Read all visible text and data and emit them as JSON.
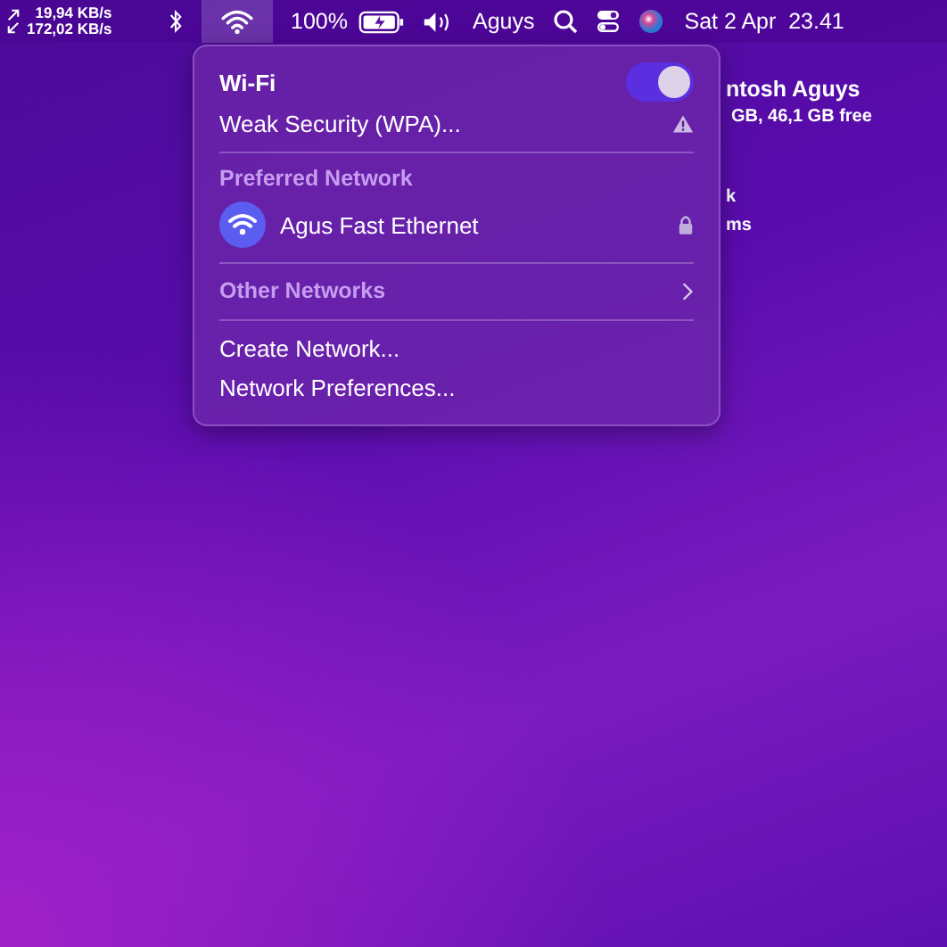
{
  "menu_bar": {
    "network_speed": {
      "upload": "19,94 KB/s",
      "download": "172,02 KB/s"
    },
    "wifi_selected": true,
    "battery": "100%",
    "user": "Aguys",
    "clock": "Sat 2 Apr  23.41"
  },
  "desktop_labels": [
    "ntosh Aguys",
    "GB, 46,1 GB free",
    "k",
    "ms"
  ],
  "wifi_menu": {
    "title": "Wi-Fi",
    "on": true,
    "warning": "Weak Security (WPA)...",
    "preferred_header": "Preferred Network",
    "networks": [
      {
        "name": "Agus Fast Ethernet",
        "locked": true
      }
    ],
    "other_networks": "Other Networks",
    "actions": [
      "Create Network...",
      "Network Preferences..."
    ]
  }
}
